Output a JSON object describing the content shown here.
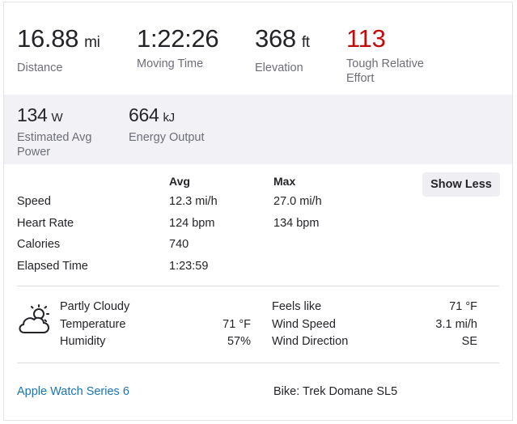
{
  "stats": [
    {
      "value": "16.88",
      "unit": "mi",
      "label": "Distance"
    },
    {
      "value": "1:22:26",
      "unit": "",
      "label": "Moving Time"
    },
    {
      "value": "368",
      "unit": "ft",
      "label": "Elevation"
    },
    {
      "value": "113",
      "unit": "",
      "label_line1": "Tough Relative",
      "label_line2": "Effort"
    }
  ],
  "secondary_stats": [
    {
      "value": "134",
      "unit": "W",
      "label_line1": "Estimated Avg",
      "label_line2": "Power"
    },
    {
      "value": "664",
      "unit": "kJ",
      "label": "Energy Output"
    }
  ],
  "details": {
    "col_avg": "Avg",
    "col_max": "Max",
    "show_less_label": "Show Less",
    "rows": [
      {
        "label": "Speed",
        "avg": "12.3 mi/h",
        "max": "27.0 mi/h"
      },
      {
        "label": "Heart Rate",
        "avg": "124 bpm",
        "max": "134 bpm"
      },
      {
        "label": "Calories",
        "avg": "740",
        "max": ""
      },
      {
        "label": "Elapsed Time",
        "avg": "1:23:59",
        "max": ""
      }
    ]
  },
  "weather": {
    "condition": "Partly Cloudy",
    "temperature_label": "Temperature",
    "temperature_value": "71 °F",
    "humidity_label": "Humidity",
    "humidity_value": "57%",
    "feels_like_label": "Feels like",
    "feels_like_value": "71 °F",
    "wind_speed_label": "Wind Speed",
    "wind_speed_value": "3.1 mi/h",
    "wind_direction_label": "Wind Direction",
    "wind_direction_value": "SE",
    "icon": "partly-cloudy-icon"
  },
  "footer": {
    "device": "Apple Watch Series 6",
    "bike": "Bike: Trek Domane SL5"
  },
  "colors": {
    "effort_red": "#c20c0c",
    "link_blue": "#1a73b5",
    "band_gray": "#f2f2f6"
  }
}
